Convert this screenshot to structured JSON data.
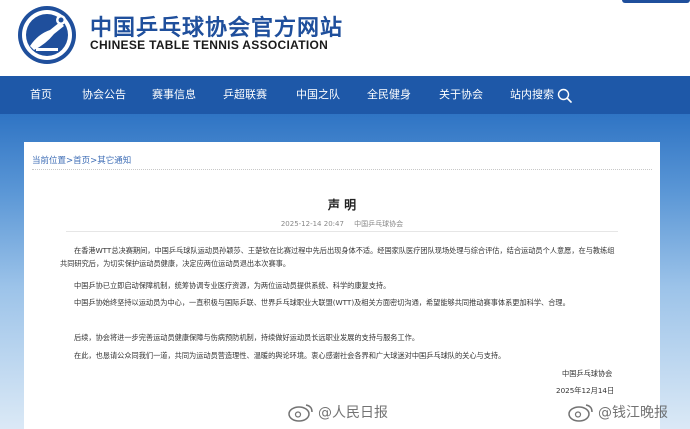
{
  "header": {
    "title_cn": "中国乒乓球协会官方网站",
    "title_en": "CHINESE TABLE TENNIS ASSOCIATION"
  },
  "nav": {
    "items": [
      "首页",
      "协会公告",
      "赛事信息",
      "乒超联赛",
      "中国之队",
      "全民健身",
      "关于协会",
      "站内搜索"
    ]
  },
  "breadcrumb": {
    "items": [
      "当前位置",
      "首页",
      "其它通知"
    ],
    "separator": ">"
  },
  "article": {
    "title": "声 明",
    "date": "2025-12-14 20:47",
    "source": "中国乒乓球协会",
    "paragraphs": [
      "在香港WTT总决赛期间，中国乒乓球队运动员孙颖莎、王楚钦在比赛过程中先后出现身体不适。经国家队医疗团队现场处理与综合评估，结合运动员个人意愿，在与教练组共同研究后，为切实保护运动员健康，决定应两位运动员退出本次赛事。",
      "中国乒协已立即启动保障机制，统筹协调专业医疗资源，为两位运动员提供系统、科学的康复支持。",
      "中国乒协始终坚持以运动员为中心，一直积极与国际乒联、世界乒乓球职业大联盟(WTT)及相关方面密切沟通，希望能够共同推动赛事体系更加科学、合理。",
      "后续，协会将进一步完善运动员健康保障与伤病预防机制，持续做好运动员长远职业发展的支持与服务工作。",
      "在此，也恳请公众同我们一道，共同为运动员营造理性、温暖的舆论环境。衷心感谢社会各界和广大球迷对中国乒乓球队的关心与支持。"
    ],
    "signature_org": "中国乒乓球协会",
    "signature_date": "2025年12月14日"
  },
  "watermarks": {
    "left": "@人民日报",
    "right": "@钱江晚报"
  },
  "colors": {
    "brand_blue": "#1e58a8",
    "title_blue": "#1f4f9c",
    "link_blue": "#3f6eb6"
  },
  "icons": [
    "association-logo-icon",
    "search-icon",
    "weibo-icon"
  ]
}
